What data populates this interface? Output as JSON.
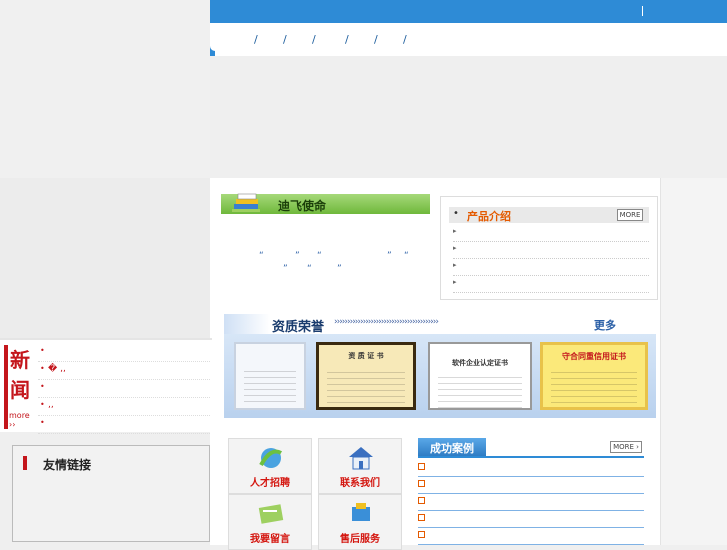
{
  "nav": {
    "separators": [
      "/",
      "/",
      "/",
      "/",
      "/",
      "/"
    ]
  },
  "topbar": {
    "separator": "|"
  },
  "news": {
    "tag_chars": [
      "新",
      "闻"
    ],
    "more_label": "more ››",
    "items": [
      {
        "text": ""
      },
      {
        "text": "�          ,,"
      },
      {
        "text": ""
      },
      {
        "text": "        ,,"
      },
      {
        "text": ""
      }
    ]
  },
  "friend_links": {
    "title": "友情链接"
  },
  "mission": {
    "title": "迪飞使命",
    "quotes_line1": [
      "“",
      "”",
      "“",
      "”",
      "“"
    ],
    "quotes_line2": [
      "”",
      "“",
      "”"
    ]
  },
  "product": {
    "title": "产品介绍",
    "bullet": "•",
    "more_label": "MORE",
    "rows": [
      "",
      "",
      "",
      ""
    ]
  },
  "honors": {
    "title": "资质荣誉",
    "arrows": "››››››››››››››››››››››››››››››››››››››››",
    "more_label": "更多",
    "certs": [
      {
        "title": "",
        "color": "#f4f7fb"
      },
      {
        "title": "资 质 证 书",
        "color": "#f7e9b8"
      },
      {
        "title": "软件企业认定证书",
        "color": "#ffffff"
      },
      {
        "title": "守合同重信用证书",
        "color": "#fbe97a"
      }
    ]
  },
  "tiles": [
    {
      "label": "人才招聘",
      "icon": "recruit-icon"
    },
    {
      "label": "联系我们",
      "icon": "house-icon"
    },
    {
      "label": "我要留言",
      "icon": "message-icon"
    },
    {
      "label": "售后服务",
      "icon": "service-icon"
    }
  ],
  "cases": {
    "title": "成功案例",
    "more_label": "MORE ›",
    "rows": [
      "",
      "",
      "",
      "",
      ""
    ]
  }
}
